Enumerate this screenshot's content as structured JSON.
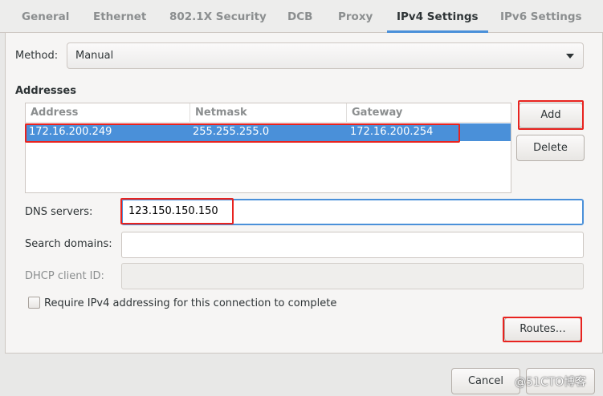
{
  "tabs": [
    {
      "label": "General"
    },
    {
      "label": "Ethernet"
    },
    {
      "label": "802.1X Security"
    },
    {
      "label": "DCB"
    },
    {
      "label": "Proxy"
    },
    {
      "label": "IPv4 Settings",
      "active": true
    },
    {
      "label": "IPv6 Settings"
    }
  ],
  "method": {
    "label": "Method:",
    "value": "Manual"
  },
  "addresses": {
    "heading": "Addresses",
    "columns": [
      "Address",
      "Netmask",
      "Gateway"
    ],
    "rows": [
      {
        "address": "172.16.200.249",
        "netmask": "255.255.255.0",
        "gateway": "172.16.200.254",
        "selected": true
      }
    ],
    "add_label": "Add",
    "delete_label": "Delete"
  },
  "dns": {
    "label": "DNS servers:",
    "value": "123.150.150.150"
  },
  "search_domains": {
    "label": "Search domains:",
    "value": ""
  },
  "dhcp_client_id": {
    "label": "DHCP client ID:",
    "value": ""
  },
  "require_ipv4": {
    "label": "Require IPv4 addressing for this connection to complete",
    "checked": false
  },
  "routes_label": "Routes…",
  "footer": {
    "cancel_label": "Cancel"
  },
  "watermark": "@51CTO博客",
  "colors": {
    "accent": "#4a90d9",
    "annotation": "#e8231f"
  }
}
